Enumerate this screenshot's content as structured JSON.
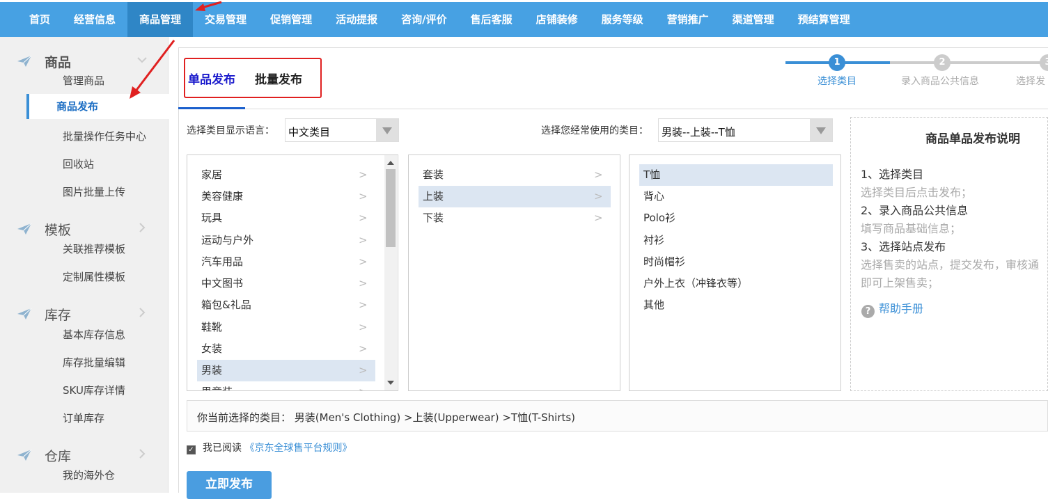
{
  "top_nav": {
    "items": [
      {
        "label": "首页"
      },
      {
        "label": "经营信息"
      },
      {
        "label": "商品管理"
      },
      {
        "label": "交易管理"
      },
      {
        "label": "促销管理"
      },
      {
        "label": "活动提报"
      },
      {
        "label": "咨询/评价"
      },
      {
        "label": "售后客服"
      },
      {
        "label": "店铺装修"
      },
      {
        "label": "服务等级"
      },
      {
        "label": "营销推广"
      },
      {
        "label": "渠道管理"
      },
      {
        "label": "预结算管理"
      }
    ],
    "active_index": 2
  },
  "sidebar": {
    "sections": [
      {
        "title": "商品",
        "items": [
          "管理商品",
          "商品发布",
          "批量操作任务中心",
          "回收站",
          "图片批量上传"
        ]
      },
      {
        "title": "模板",
        "items": [
          "关联推荐模板",
          "定制属性模板"
        ]
      },
      {
        "title": "库存",
        "items": [
          "基本库存信息",
          "库存批量编辑",
          "SKU库存详情",
          "订单库存"
        ]
      },
      {
        "title": "仓库",
        "items": [
          "我的海外仓"
        ]
      }
    ],
    "active_item": "商品发布"
  },
  "tabs": {
    "single": "单品发布",
    "batch": "批量发布"
  },
  "steps": [
    {
      "number": "1",
      "label": "选择类目"
    },
    {
      "number": "2",
      "label": "录入商品公共信息"
    },
    {
      "number": "3",
      "label": "选择发"
    }
  ],
  "language": {
    "label": "选择类目显示语言：",
    "value": "中文类目"
  },
  "frequent": {
    "label": "选择您经常使用的类目：",
    "value": "男装--上装--T恤"
  },
  "category_columns": {
    "col1": [
      "家居",
      "美容健康",
      "玩具",
      "运动与户外",
      "汽车用品",
      "中文图书",
      "箱包&礼品",
      "鞋靴",
      "女装",
      "男装",
      "男童装"
    ],
    "col1_selected": "男装",
    "col2": [
      "套装",
      "上装",
      "下装"
    ],
    "col2_selected": "上装",
    "col3": [
      "T恤",
      "背心",
      "Polo衫",
      "衬衫",
      "时尚帽衫",
      "户外上衣（冲锋衣等）",
      "其他"
    ],
    "col3_selected": "T恤",
    "arrow": ">"
  },
  "info": {
    "title": "商品单品发布说明",
    "lines": [
      {
        "text": "1、选择类目",
        "style": "dark"
      },
      {
        "text": "选择类目后点击发布；",
        "style": "light"
      },
      {
        "text": "2、录入商品公共信息",
        "style": "dark"
      },
      {
        "text": "填写商品基础信息；",
        "style": "light"
      },
      {
        "text": "3、选择站点发布",
        "style": "dark"
      },
      {
        "text": "选择售卖的站点，提交发布，审核通",
        "style": "light"
      },
      {
        "text": "即可上架售卖；",
        "style": "light"
      }
    ],
    "help_icon": "?",
    "help_label": "帮助手册"
  },
  "current_selection": {
    "text": "你当前选择的类目： 男装(Men's Clothing) >上装(Upperwear) >T恤(T-Shirts)"
  },
  "agreement": {
    "checked_mark": "✓",
    "prefix": "我已阅读",
    "link": "《京东全球售平台规则》"
  },
  "publish_button": "立即发布",
  "colors": {
    "nav_bg": "#47a1e3",
    "accent": "#3a8fd6",
    "highlight_box": "#e02020",
    "selected_row": "#dce6f2"
  }
}
